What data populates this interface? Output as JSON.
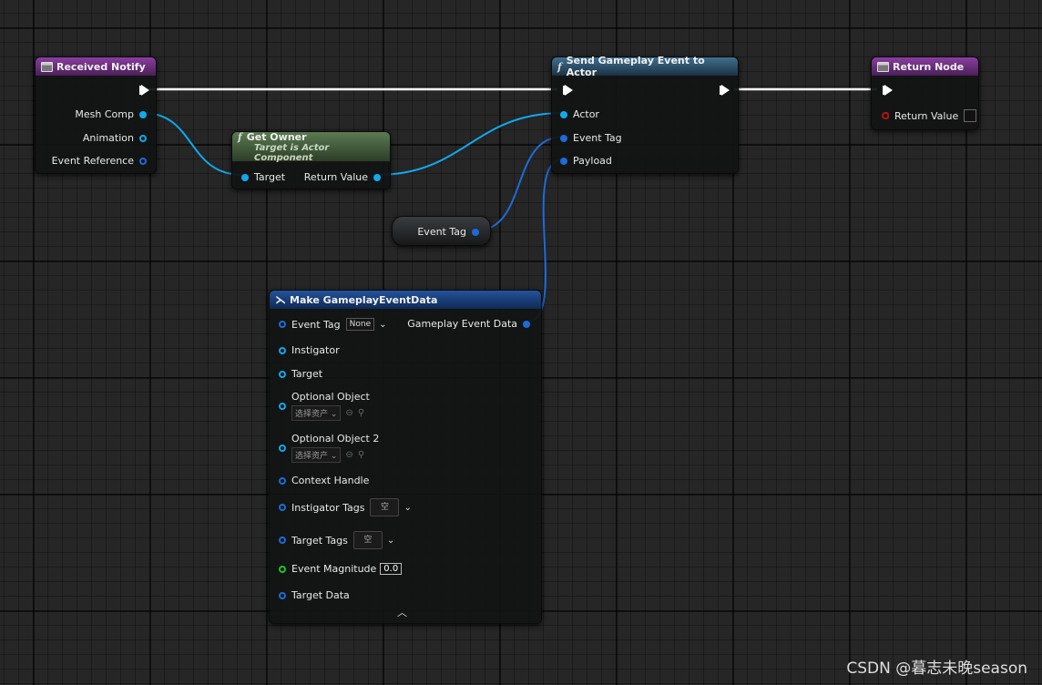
{
  "nodes": {
    "received_notify": {
      "title": "Received Notify",
      "pins": [
        "Mesh Comp",
        "Animation",
        "Event Reference"
      ]
    },
    "get_owner": {
      "title": "Get Owner",
      "subtitle": "Target is Actor Component",
      "input": "Target",
      "output": "Return Value"
    },
    "send_gameplay_event": {
      "title": "Send Gameplay Event to Actor",
      "pins": [
        "Actor",
        "Event Tag",
        "Payload"
      ]
    },
    "return_node": {
      "title": "Return Node",
      "pin": "Return Value"
    },
    "event_tag_var": {
      "label": "Event Tag"
    },
    "make_event_data": {
      "title": "Make GameplayEventData",
      "output": "Gameplay Event Data",
      "event_tag": {
        "label": "Event Tag",
        "value": "None"
      },
      "instigator": "Instigator",
      "target": "Target",
      "optional_object": {
        "label": "Optional Object",
        "select": "选择资产"
      },
      "optional_object_2": {
        "label": "Optional Object 2",
        "select": "选择资产"
      },
      "context_handle": "Context Handle",
      "instigator_tags": {
        "label": "Instigator Tags",
        "value": "空"
      },
      "target_tags": {
        "label": "Target Tags",
        "value": "空"
      },
      "event_magnitude": {
        "label": "Event Magnitude",
        "value": "0.0"
      },
      "target_data": "Target Data"
    }
  },
  "watermark": "CSDN @暮志未晚season",
  "colors": {
    "exec_wire": "#ffffff",
    "object_wire": "#11a9ec",
    "struct_wire": "#1d6bd9",
    "event_header": "#8a3ea0",
    "function_header": "#3f6f90",
    "pure_function_header": "#5b7a52",
    "make_struct_header": "#24529b"
  },
  "icons": [
    "event-icon",
    "function-icon",
    "make-struct-icon",
    "exec-pin-icon",
    "chevron-down-icon",
    "browse-arrow-icon",
    "magnifier-icon",
    "collapse-chevron-up-icon"
  ]
}
